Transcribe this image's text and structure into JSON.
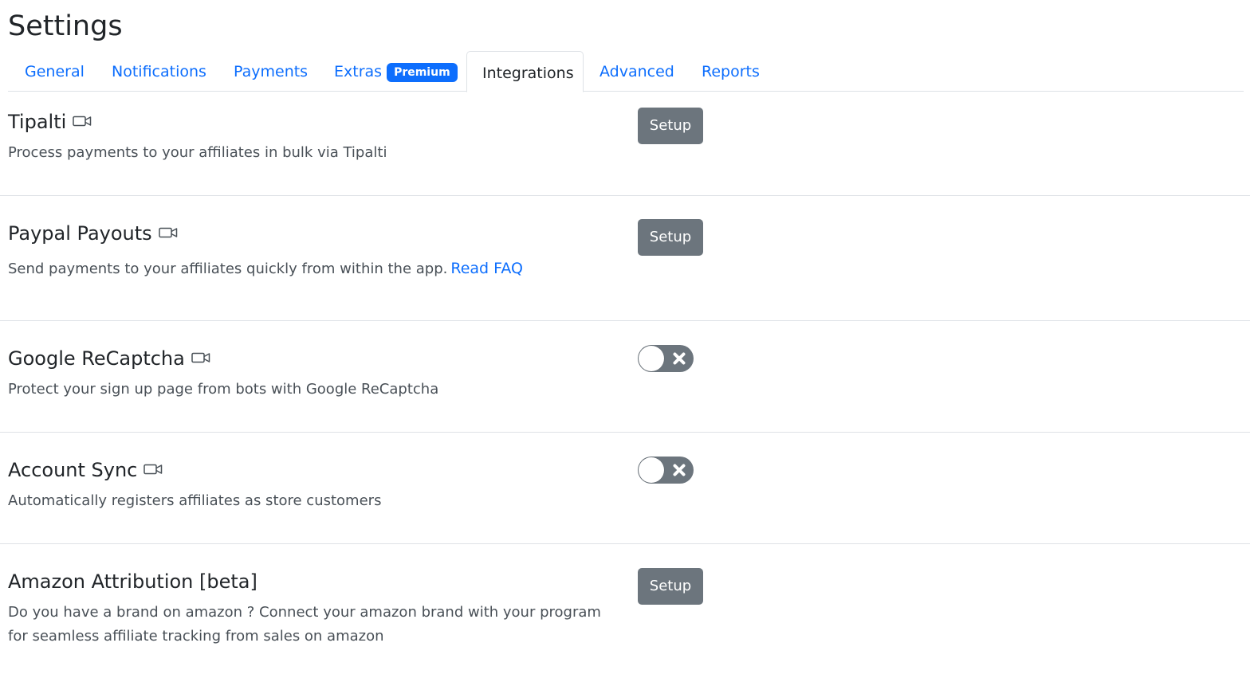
{
  "page": {
    "title": "Settings"
  },
  "tabs": [
    {
      "label": "General",
      "active": false
    },
    {
      "label": "Notifications",
      "active": false
    },
    {
      "label": "Payments",
      "active": false
    },
    {
      "label": "Extras",
      "badge": "Premium",
      "active": false
    },
    {
      "label": "Integrations",
      "active": true
    },
    {
      "label": "Advanced",
      "active": false
    },
    {
      "label": "Reports",
      "active": false
    }
  ],
  "integrations": [
    {
      "title": "Tipalti",
      "icon": "video-camera-icon",
      "description": "Process payments to your affiliates in bulk via Tipalti",
      "control": "button",
      "button_label": "Setup"
    },
    {
      "title": "Paypal Payouts",
      "icon": "video-camera-icon",
      "description": "Send payments to your affiliates quickly from within the app.",
      "link_text": "Read FAQ",
      "control": "button",
      "button_label": "Setup"
    },
    {
      "title": "Google ReCaptcha",
      "icon": "video-camera-icon",
      "description": "Protect your sign up page from bots with Google ReCaptcha",
      "control": "toggle",
      "enabled": false
    },
    {
      "title": "Account Sync",
      "icon": "video-camera-icon",
      "description": "Automatically registers affiliates as store customers",
      "control": "toggle",
      "enabled": false
    },
    {
      "title": "Amazon Attribution [beta]",
      "description": "Do you have a brand on amazon ? Connect your amazon brand with your program for seamless affiliate tracking from sales on amazon",
      "control": "button",
      "button_label": "Setup"
    }
  ],
  "colors": {
    "link": "#0d6efd",
    "badge": "#0d6efd",
    "button": "#6c757d",
    "toggle_off": "#6c757d"
  }
}
